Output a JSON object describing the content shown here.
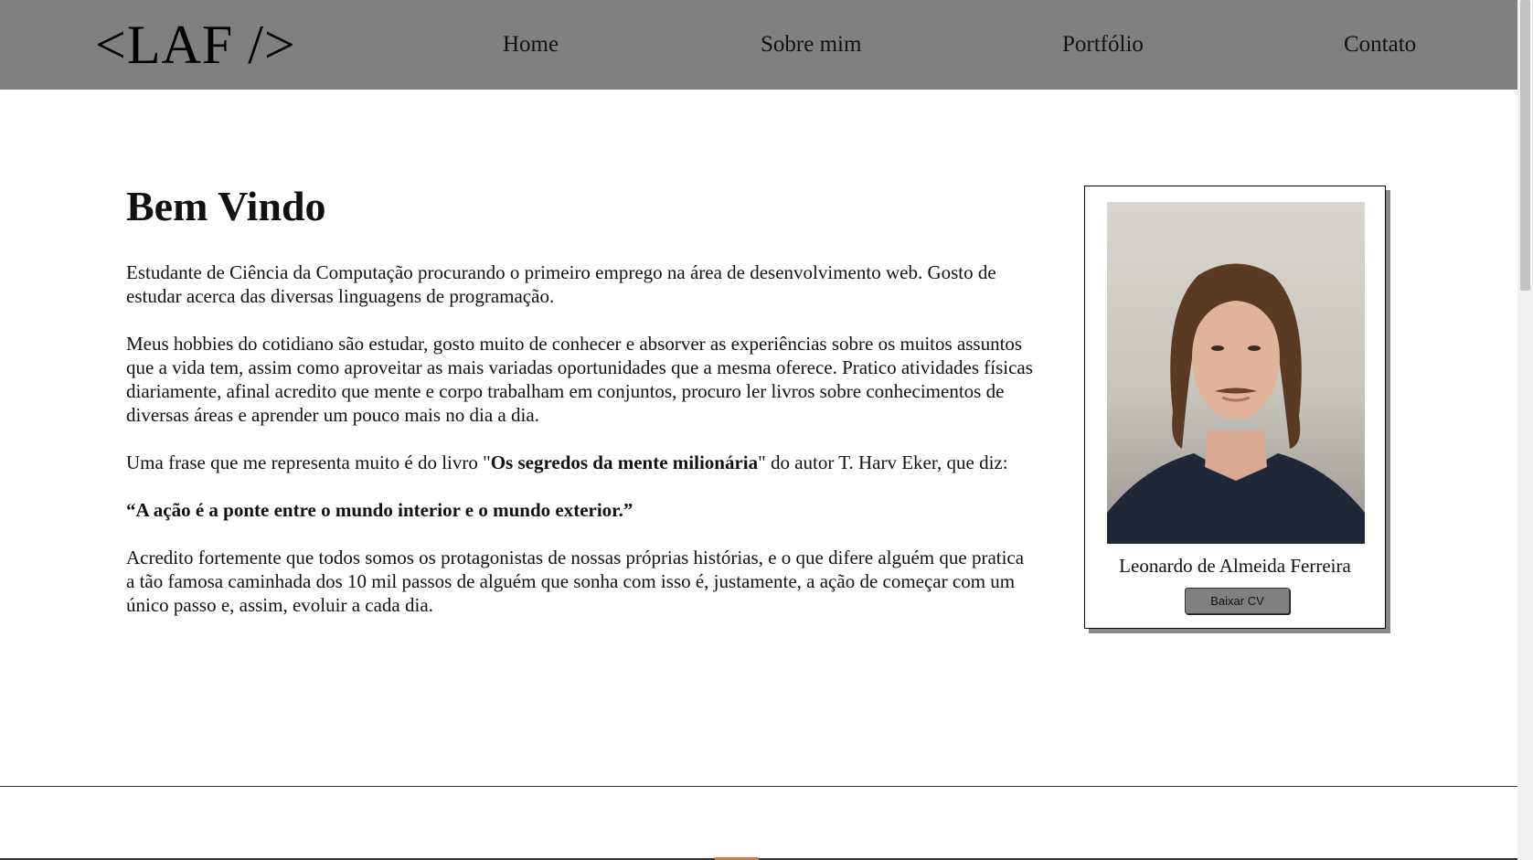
{
  "header": {
    "logo": "<LAF />",
    "nav": [
      "Home",
      "Sobre mim",
      "Portfólio",
      "Contato"
    ]
  },
  "main": {
    "title": "Bem Vindo",
    "paragraph1": "Estudante de Ciência da Computação procurando o primeiro emprego na área de desenvolvimento web. Gosto de estudar acerca das diversas linguagens de programação.",
    "paragraph2": "Meus hobbies do cotidiano são estudar, gosto muito de conhecer e absorver as experiências sobre os muitos assuntos que a vida tem, assim como aproveitar as mais variadas oportunidades que a mesma oferece. Pratico atividades físicas diariamente, afinal acredito que mente e corpo trabalham em conjuntos, procuro ler livros sobre conhecimentos de diversas áreas e aprender um pouco mais no dia a dia.",
    "paragraph3_before": "Uma frase que me representa muito é do livro \"",
    "paragraph3_book": "Os segredos da mente milionária",
    "paragraph3_after": "\" do autor T. Harv Eker, que diz:",
    "quote": "“A ação é a ponte entre o mundo interior e o mundo exterior.”",
    "paragraph4": "Acredito fortemente que todos somos os protagonistas de nossas próprias histórias, e o que difere alguém que pratica a tão famosa caminhada dos 10 mil passos de alguém que sonha com isso é, justamente, a ação de começar com um único passo e, assim, evoluir a cada dia."
  },
  "profile": {
    "name": "Leonardo de Almeida Ferreira",
    "button": "Baixar CV"
  },
  "colors": {
    "navbar": "#808080",
    "button": "#808080",
    "accent": "#c8804a"
  }
}
